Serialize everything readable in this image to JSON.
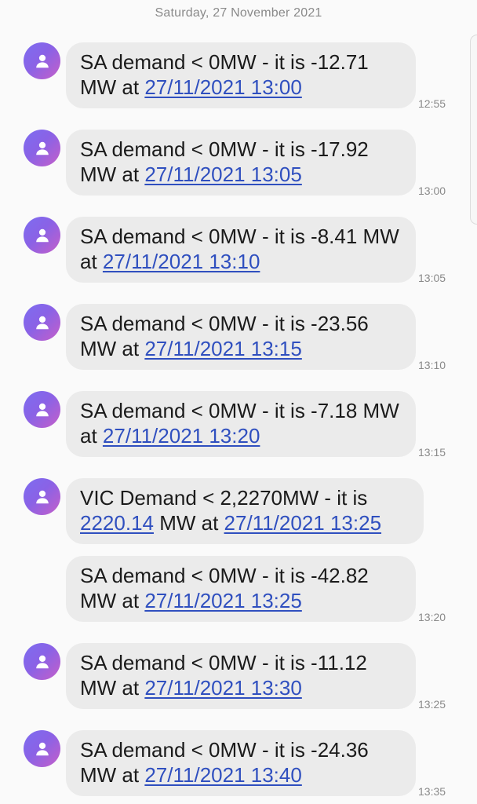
{
  "date_header": "Saturday, 27 November 2021",
  "messages": [
    {
      "text": "SA demand < 0MW - it is -12.71 MW at ",
      "link": "27/11/2021 13:00",
      "time": "12:55"
    },
    {
      "text": "SA demand < 0MW - it is -17.92 MW at ",
      "link": "27/11/2021 13:05",
      "time": "13:00"
    },
    {
      "text": "SA demand < 0MW - it is -8.41 MW at ",
      "link": "27/11/2021 13:10",
      "time": "13:05"
    },
    {
      "text": "SA demand < 0MW - it is -23.56 MW at ",
      "link": "27/11/2021 13:15",
      "time": "13:10"
    },
    {
      "text": "SA demand < 0MW - it is -7.18 MW at ",
      "link": "27/11/2021 13:20",
      "time": "13:15"
    },
    {
      "vic_text_1": "VIC Demand < 2,2270MW - it is ",
      "vic_link_1": "2220.14",
      "vic_text_2": " MW at ",
      "vic_link_2": "27/11/2021 13:25"
    },
    {
      "text": "SA demand < 0MW - it is -42.82 MW at ",
      "link": "27/11/2021 13:25",
      "time": "13:20"
    },
    {
      "text": "SA demand < 0MW - it is -11.12 MW at ",
      "link": "27/11/2021 13:30",
      "time": "13:25"
    },
    {
      "text": "SA demand < 0MW - it is -24.36 MW at ",
      "link": "27/11/2021 13:40",
      "time": "13:35"
    }
  ]
}
